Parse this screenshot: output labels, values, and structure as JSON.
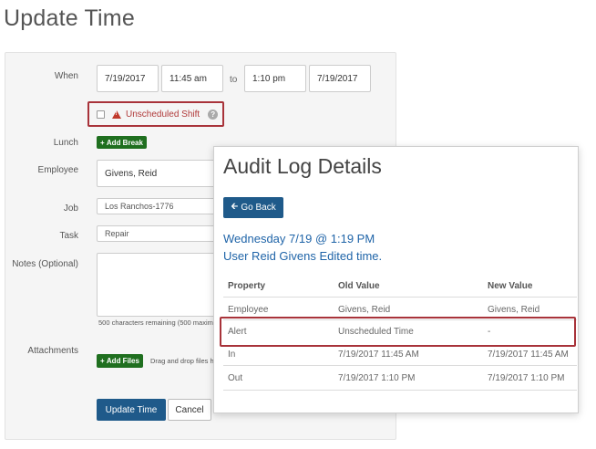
{
  "page": {
    "title": "Update Time"
  },
  "form": {
    "when_label": "When",
    "start_date": "7/19/2017",
    "start_time": "11:45 am",
    "to_label": "to",
    "end_time": "1:10 pm",
    "end_date": "7/19/2017",
    "unscheduled_label": "Unscheduled Shift",
    "help_glyph": "?",
    "lunch_label": "Lunch",
    "add_break_label": "Add Break",
    "employee_label": "Employee",
    "employee_value": "Givens, Reid",
    "job_label": "Job",
    "job_value": "Los Ranchos-1776",
    "task_label": "Task",
    "task_value": "Repair",
    "notes_label": "Notes (Optional)",
    "notes_hint": "500 characters remaining (500 maxim",
    "attachments_label": "Attachments",
    "add_files_label": "Add Files",
    "drag_hint": "Drag and drop files h",
    "update_button": "Update Time",
    "cancel_button": "Cancel"
  },
  "audit": {
    "title": "Audit Log Details",
    "back_button": "Go Back",
    "date_line": "Wednesday 7/19 @ 1:19 PM",
    "user_line": "User Reid Givens Edited time.",
    "columns": [
      "Property",
      "Old Value",
      "New Value"
    ],
    "rows": [
      {
        "property": "Employee",
        "old": "Givens, Reid",
        "new": "Givens, Reid"
      },
      {
        "property": "Alert",
        "old": "Unscheduled Time",
        "new": "-"
      },
      {
        "property": "In",
        "old": "7/19/2017 11:45 AM",
        "new": "7/19/2017 11:45 AM"
      },
      {
        "property": "Out",
        "old": "7/19/2017 1:10 PM",
        "new": "7/19/2017 1:10 PM"
      }
    ]
  },
  "colors": {
    "accent_blue": "#1f5a8a",
    "link_blue": "#1f64a8",
    "green_button": "#1f6f1f",
    "highlight_red": "#a8333a"
  },
  "icons": {
    "warning": "warning-triangle-icon",
    "help": "question-circle-icon",
    "plus": "plus-icon",
    "back_arrow": "arrow-left-icon"
  }
}
